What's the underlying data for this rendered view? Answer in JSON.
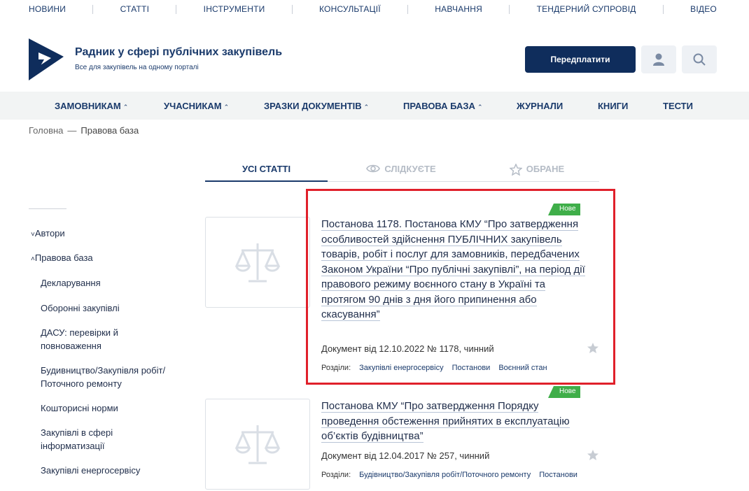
{
  "topnav": [
    "НОВИНИ",
    "СТАТТІ",
    "ІНСТРУМЕНТИ",
    "КОНСУЛЬТАЦІЇ",
    "НАВЧАННЯ",
    "ТЕНДЕРНИЙ СУПРОВІД",
    "ВІДЕО"
  ],
  "header": {
    "title": "Радник у сфері публічних закупівель",
    "subtitle": "Все для закупівель на одному порталі",
    "subscribe_label": "Передплатити",
    "accent_color": "#0f2d5c"
  },
  "mainnav": [
    "ЗАМОВНИКАМ",
    "УЧАСНИКАМ",
    "ЗРАЗКИ ДОКУМЕНТІВ",
    "ПРАВОВА БАЗА",
    "ЖУРНАЛИ",
    "КНИГИ",
    "ТЕСТИ"
  ],
  "breadcrumb": {
    "home": "Головна",
    "sep": "—",
    "current": "Правова база"
  },
  "tabs": {
    "all": "УСІ СТАТТІ",
    "follow": "СЛІДКУЄТЕ",
    "favorites": "ОБРАНЕ"
  },
  "sidebar": {
    "authors": "Автори",
    "legal_base": "Правова база",
    "items": [
      "Декларування",
      "Оборонні закупівлі",
      "ДАСУ: перевірки й повноваження",
      "Будивництво/Закупівля робіт/ Поточного ремонту",
      "Кошторисні норми",
      "Закупівлі в сфері інформатизації",
      "Закупівлі енергосервісу"
    ]
  },
  "cards": [
    {
      "badge": "Нове",
      "title": "Постанова 1178. Постанова КМУ “Про затвердження особливостей здійснення ПУБЛІЧНИХ закупівель товарів, робіт і послуг для замовників, передбачених Законом України “Про публічні закупівлі”, на період дії правового режиму воєнного стану в Україні та протягом 90 днів з дня його припинення або скасування”",
      "meta": "Документ від 12.10.2022 № 1178, чинний",
      "sections_label": "Розділи:",
      "sections": [
        "Закупівлі енергосервісу",
        "Постанови",
        "Воєнний стан"
      ]
    },
    {
      "badge": "Нове",
      "title": "Постанова КМУ “Про затвердження Порядку проведення обстеження прийнятих в експлуатацію об’єктів будівництва”",
      "meta": "Документ від 12.04.2017 № 257, чинний",
      "sections_label": "Розділи:",
      "sections": [
        "Будівництво/Закупівля робіт/Поточного ремонту",
        "Постанови"
      ]
    }
  ]
}
